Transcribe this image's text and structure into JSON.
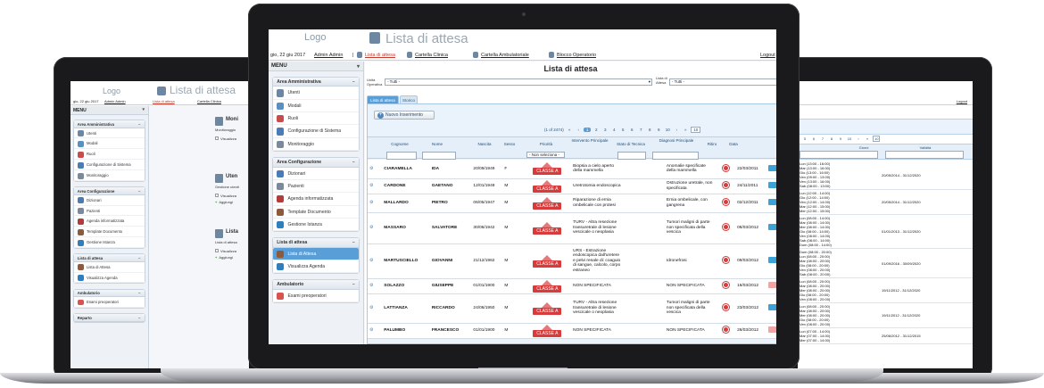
{
  "colors": {
    "accent": "#5a9ed8",
    "brand_red": "#d83b3b",
    "sidebar": "#eef2f6"
  },
  "left": {
    "logo": "Logo",
    "title": "Lista di attesa",
    "date": "gio, 22 giu 2017",
    "user": "Admin Admin",
    "nav": [
      "Lista di attesa",
      "Cartella Clinica"
    ],
    "menu": "MENU",
    "sections": [
      {
        "title": "Area Amministrativa",
        "items": [
          "Utenti",
          "Modali",
          "Ruoli",
          "Configurazione di Sistema",
          "Monitoraggio"
        ]
      },
      {
        "title": "Area Configurazione",
        "items": [
          "Dizionari",
          "Pazienti",
          "Agenda informatizzata",
          "Template Documento",
          "Gestione Istanza"
        ]
      },
      {
        "title": "Lista di attesa",
        "items": [
          "Lista di Attesa",
          "Visualizza Agenda"
        ]
      },
      {
        "title": "Ambulatorio",
        "items": [
          "Esami preoperatori"
        ]
      },
      {
        "title": "Reparto",
        "items": []
      }
    ],
    "cards": [
      {
        "title": "Moni",
        "sub": "Monitoraggio",
        "action": "Visualizza"
      },
      {
        "title": "Uten",
        "sub": "Gestione utenti",
        "action": "Visualizza",
        "action2": "Aggiungi"
      },
      {
        "title": "Lista",
        "sub": "Lista di attesa",
        "action": "Visualizza",
        "action2": "Aggiungi"
      }
    ]
  },
  "center": {
    "logo": "Logo",
    "title": "Lista di attesa",
    "date": "gio, 22 giu 2017",
    "user": "Admin Admin",
    "nav": [
      "Lista di attesa",
      "Cartella Clinica",
      "Cartella Ambulatoriale",
      "Blocco Operatorio"
    ],
    "logout": "Logout",
    "menu": "MENU",
    "sections": [
      {
        "title": "Area Amministrativa",
        "items": [
          "Utenti",
          "Modali",
          "Ruoli",
          "Configurazione di Sistema",
          "Monitoraggio"
        ]
      },
      {
        "title": "Area Configurazione",
        "items": [
          "Dizionari",
          "Pazienti",
          "Agenda informatizzata",
          "Template Documento",
          "Gestione Istanza"
        ]
      },
      {
        "title": "Lista di attesa",
        "items": [
          "Lista di Attesa",
          "Visualizza Agenda"
        ]
      },
      {
        "title": "Ambulatorio",
        "items": [
          "Esami preoperatori"
        ]
      }
    ],
    "heading": "Lista di attesa",
    "filter_uo_label": "Unità Operativa",
    "filter_uo_value": "- Tutti -",
    "filter_la_label": "Lista di Attesa",
    "filter_la_value": "- Tutti -",
    "tabs": [
      "Lista di attesa",
      "Storico"
    ],
    "new_button": "Nuovo Inserimento",
    "pager_info": "(1 of 2474)",
    "pages": [
      "1",
      "2",
      "3",
      "4",
      "5",
      "6",
      "7",
      "8",
      "9",
      "10"
    ],
    "rows_per_page": "10",
    "columns": [
      "Cognome",
      "Nome",
      "Nascita",
      "Sesso",
      "Priorità",
      "Intervento Principale",
      "Stato di Tecnica",
      "Diagnosi Principale",
      "Ritiro",
      "Data"
    ],
    "priority_filter": "- Non seleziona -",
    "rows": [
      {
        "cognome": "CIARAMELLA",
        "nome": "IDA",
        "nascita": "20/09/1949",
        "sesso": "F",
        "classe": "CLASSE A",
        "intervento": "Biopsia a cielo aperto della mammella",
        "diagnosi": "Anomalie specificate della mammella",
        "data": "22/03/2011",
        "pill": "blue"
      },
      {
        "cognome": "CARDONE",
        "nome": "GAETANO",
        "nascita": "12/01/1949",
        "sesso": "M",
        "classe": "CLASSE A",
        "intervento": "Uretrotomia endoscopica",
        "diagnosi": "Ostruzione uretrale, non specificata",
        "data": "24/11/2011",
        "pill": "blue"
      },
      {
        "cognome": "MALLARDO",
        "nome": "PIETRO",
        "nascita": "06/05/1947",
        "sesso": "M",
        "classe": "CLASSE A",
        "intervento": "Riparazione di ernia ombelicale con protesi",
        "diagnosi": "Ernia ombelicale, con gangrena",
        "data": "02/12/2011",
        "pill": "blue"
      },
      {
        "cognome": "MASSARO",
        "nome": "SALVATORE",
        "nascita": "30/06/1942",
        "sesso": "M",
        "classe": "CLASSE A",
        "intervento": "TURV - Altra resezione transuretrale di lesione vescicale o neoplasia",
        "diagnosi": "Tumori maligni di parte non specificata della vescica",
        "data": "06/03/2012",
        "pill": "blue"
      },
      {
        "cognome": "MARTUSCIELLO",
        "nome": "GIOVANNI",
        "nascita": "21/12/1962",
        "sesso": "M",
        "classe": "CLASSE A",
        "intervento": "URS - Estrazione endoscopica dall'uretere e pelvi renale di: coaguio di sangue, calcolo, corpo estraneo",
        "diagnosi": "Idronefrosi",
        "data": "09/03/2012",
        "pill": "blue"
      },
      {
        "cognome": "SOLAZZO",
        "nome": "GIUSEPPE",
        "nascita": "01/01/1900",
        "sesso": "M",
        "classe": "CLASSE A",
        "intervento": "NON SPECIFICATA",
        "diagnosi": "NON SPECIFICATA",
        "data": "16/03/2012",
        "pill": "pink"
      },
      {
        "cognome": "LATTIANZA",
        "nome": "RICCARDO",
        "nascita": "24/06/1950",
        "sesso": "M",
        "classe": "CLASSE A",
        "intervento": "TURV - Altra resezione transuretrale di lesione vescicale o neoplasia",
        "diagnosi": "Tumori maligni di parte non specificata della vescica",
        "data": "23/03/2012",
        "pill": "blue"
      },
      {
        "cognome": "PALUMBO",
        "nome": "FRANCESCO",
        "nascita": "01/01/1900",
        "sesso": "M",
        "classe": "CLASSE A",
        "intervento": "NON SPECIFICATA",
        "diagnosi": "NON SPECIFICATA",
        "data": "26/03/2012",
        "pill": "pink"
      }
    ]
  },
  "right": {
    "logout": "Logout",
    "pages": [
      "5",
      "6",
      "7",
      "8",
      "9",
      "10"
    ],
    "rows_per_page": "10",
    "columns": [
      "Giorni",
      "Validità"
    ],
    "rows": [
      {
        "giorni": [
          "Lun (13:00 - 16:00)",
          "Mar (13:00 - 16:00)",
          "Gio (13:00 - 16:00)",
          "Ven (09:00 - 13:00)",
          "Ven (13:00 - 16:00)",
          "Sab (08:00 - 13:00)"
        ],
        "validita": "20/05/2014 - 31/12/2020"
      },
      {
        "giorni": [
          "Lun (12:00 - 14:00)",
          "Gio (12:00 - 14:00)",
          "Ven (12:00 - 14:00)",
          "Mar (12:00 - 15:00)",
          "Mer (12:00 - 15:00)"
        ],
        "validita": "20/05/2014 - 31/12/2020"
      },
      {
        "giorni": [
          "Lun (08:00 - 14:00)",
          "Mar (08:00 - 14:00)",
          "Mer (08:00 - 14:00)",
          "Gio (08:00 - 14:00)",
          "Ven (08:00 - 14:00)",
          "Sab (08:00 - 14:00)",
          "Dom (08:00 - 14:00)"
        ],
        "validita": "01/01/2013 - 31/12/2020"
      },
      {
        "giorni": [
          "Dom (08:00 - 20:00)",
          "Lun (08:00 - 20:00)",
          "Mar (08:00 - 20:00)",
          "Gio (08:00 - 20:00)",
          "Ven (08:00 - 20:00)",
          "Sab (08:00 - 20:00)"
        ],
        "validita": "01/09/2016 - 30/09/2020"
      },
      {
        "giorni": [
          "Lun (08:00 - 20:00)",
          "Mar (08:00 - 20:00)",
          "Mer (08:00 - 20:00)",
          "Gio (08:00 - 20:00)",
          "Ven (08:00 - 20:00)"
        ],
        "validita": "19/11/2012 - 31/12/2020"
      },
      {
        "giorni": [
          "Lun (08:00 - 20:00)",
          "Mar (08:00 - 20:00)",
          "Mer (08:00 - 20:00)",
          "Gio (08:00 - 20:00)",
          "Ven (08:00 - 20:00)"
        ],
        "validita": "19/11/2012 - 31/12/2020"
      },
      {
        "giorni": [
          "Lun (07:00 - 14:00)",
          "Mar (07:00 - 14:00)",
          "Mer (07:00 - 14:00)"
        ],
        "validita": "25/06/2012 - 31/12/2015"
      }
    ]
  }
}
